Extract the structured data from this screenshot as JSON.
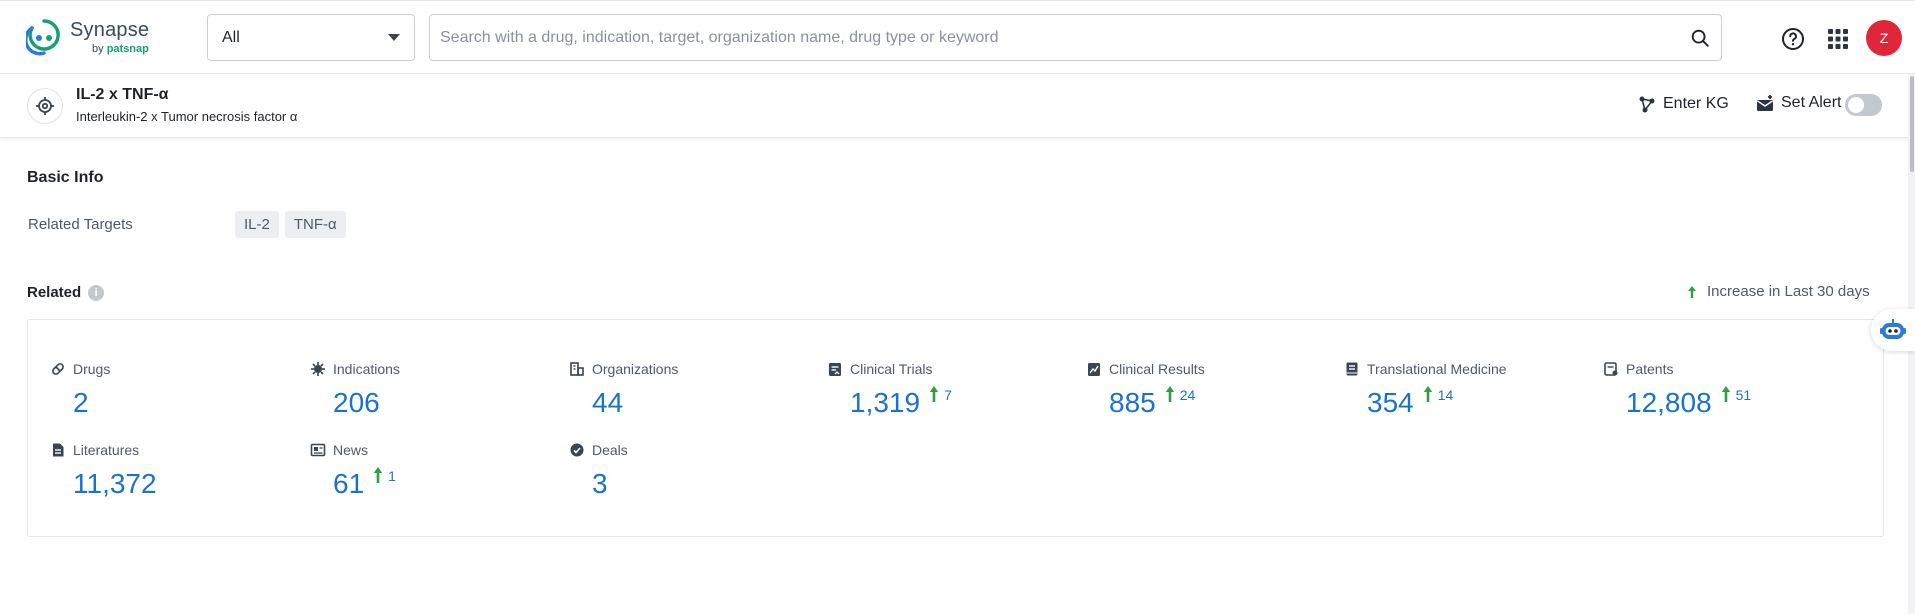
{
  "header": {
    "logo_name": "Synapse",
    "logo_by": "by",
    "logo_brand": "patsnap",
    "scope_value": "All",
    "search_placeholder": "Search with a drug, indication, target, organization name, drug type or keyword",
    "avatar_letter": "Z"
  },
  "target": {
    "title": "IL-2 x TNF-α",
    "subtitle": "Interleukin-2 x Tumor necrosis factor α",
    "enter_kg": "Enter KG",
    "set_alert": "Set Alert",
    "alert_enabled": false
  },
  "basic_info": {
    "title": "Basic Info",
    "related_targets_label": "Related Targets",
    "related_targets": [
      "IL-2",
      "TNF-α"
    ]
  },
  "related": {
    "title": "Related",
    "legend": "Increase in Last 30 days",
    "metrics": [
      {
        "label": "Drugs",
        "value": "2",
        "increase": "",
        "icon": "pill-icon"
      },
      {
        "label": "Indications",
        "value": "206",
        "increase": "",
        "icon": "virus-icon"
      },
      {
        "label": "Organizations",
        "value": "44",
        "increase": "",
        "icon": "building-icon"
      },
      {
        "label": "Clinical Trials",
        "value": "1,319",
        "increase": "7",
        "icon": "clipboard-icon"
      },
      {
        "label": "Clinical Results",
        "value": "885",
        "increase": "24",
        "icon": "chart-doc-icon"
      },
      {
        "label": "Translational Medicine",
        "value": "354",
        "increase": "14",
        "icon": "book-icon"
      },
      {
        "label": "Patents",
        "value": "12,808",
        "increase": "51",
        "icon": "patent-icon"
      },
      {
        "label": "Literatures",
        "value": "11,372",
        "increase": "",
        "icon": "document-icon"
      },
      {
        "label": "News",
        "value": "61",
        "increase": "1",
        "icon": "newspaper-icon"
      },
      {
        "label": "Deals",
        "value": "3",
        "increase": "",
        "icon": "deal-icon"
      }
    ]
  },
  "colors": {
    "accent": "#1a73c9",
    "increase": "#2ea043",
    "avatar": "#e0273a",
    "brand_green": "#1a9f74"
  }
}
